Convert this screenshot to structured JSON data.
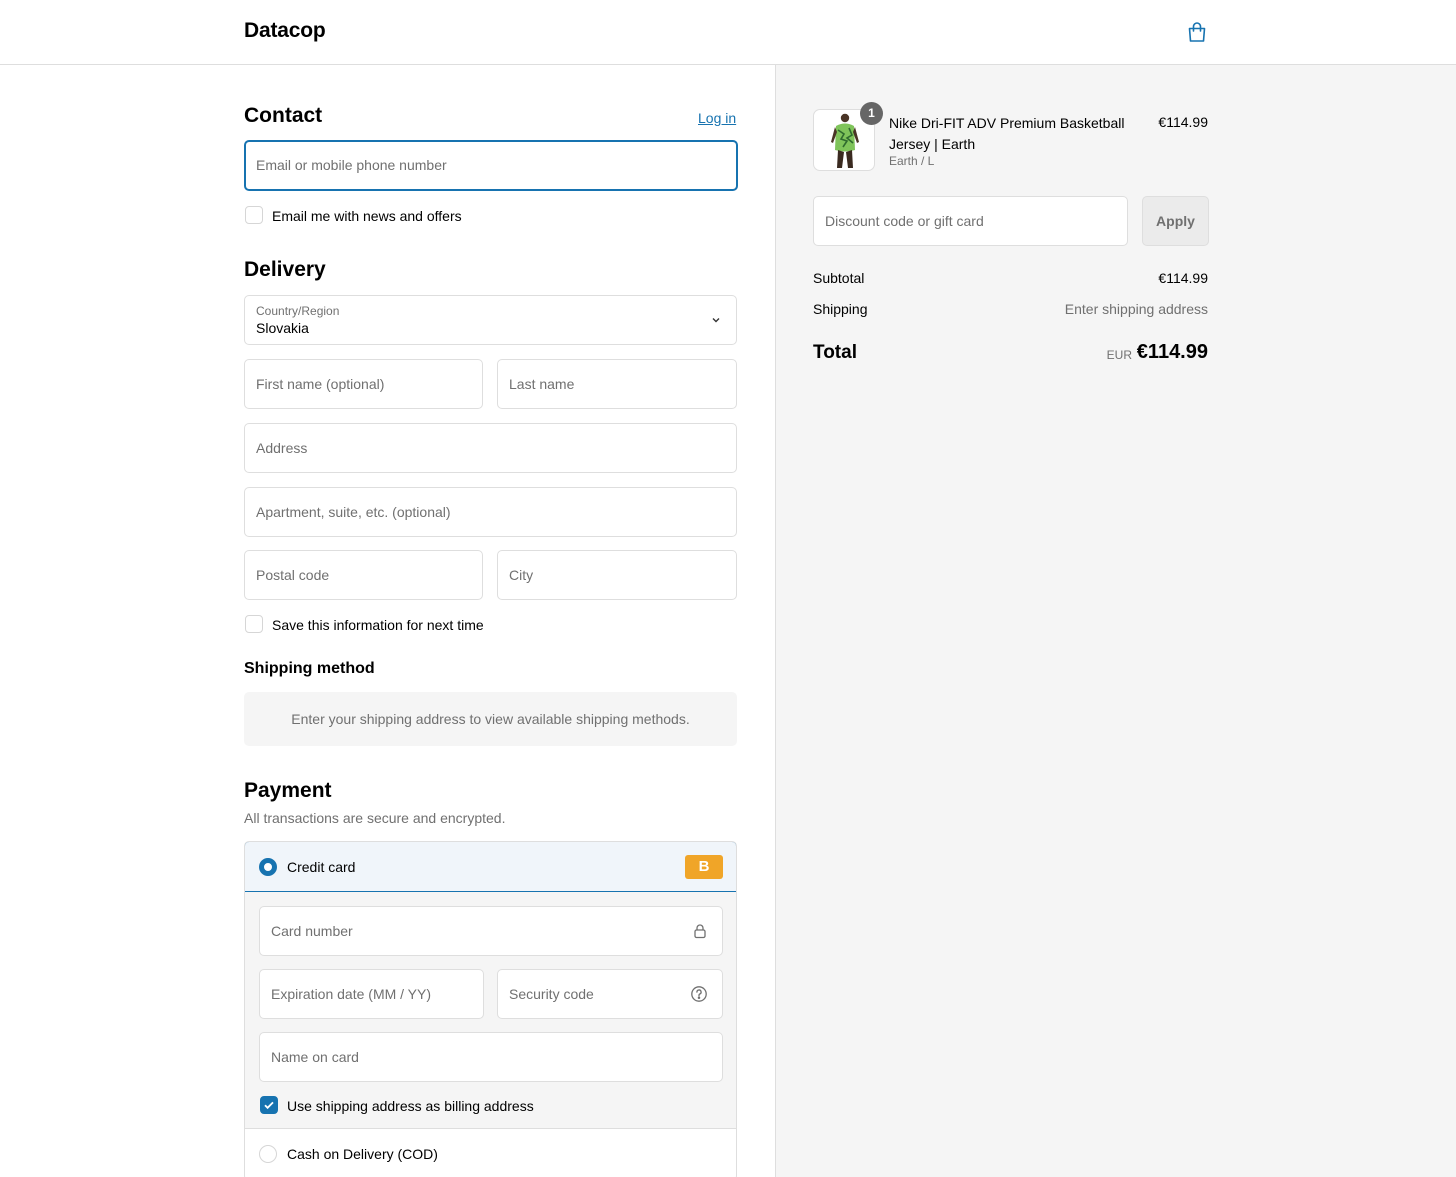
{
  "header": {
    "brand": "Datacop"
  },
  "contact": {
    "title": "Contact",
    "login_link": "Log in",
    "email_placeholder": "Email or mobile phone number",
    "newsletter_label": "Email me with news and offers"
  },
  "delivery": {
    "title": "Delivery",
    "country_label": "Country/Region",
    "country_value": "Slovakia",
    "first_name_placeholder": "First name (optional)",
    "last_name_placeholder": "Last name",
    "address_placeholder": "Address",
    "apartment_placeholder": "Apartment, suite, etc. (optional)",
    "postal_placeholder": "Postal code",
    "city_placeholder": "City",
    "save_info_label": "Save this information for next time"
  },
  "shipping_method": {
    "title": "Shipping method",
    "notice": "Enter your shipping address to view available shipping methods."
  },
  "payment": {
    "title": "Payment",
    "subtitle": "All transactions are secure and encrypted.",
    "credit_card_label": "Credit card",
    "card_badge": "B",
    "card_number_placeholder": "Card number",
    "expiry_placeholder": "Expiration date (MM / YY)",
    "security_placeholder": "Security code",
    "name_on_card_placeholder": "Name on card",
    "billing_same_label": "Use shipping address as billing address",
    "cod_label": "Cash on Delivery (COD)"
  },
  "summary": {
    "product": {
      "name": "Nike Dri-FIT ADV Premium Basketball Jersey | Earth",
      "variant": "Earth / L",
      "price": "€114.99",
      "quantity": "1"
    },
    "discount_placeholder": "Discount code or gift card",
    "apply_label": "Apply",
    "subtotal_label": "Subtotal",
    "subtotal_value": "€114.99",
    "shipping_label": "Shipping",
    "shipping_value": "Enter shipping address",
    "total_label": "Total",
    "total_currency": "EUR",
    "total_value": "€114.99"
  },
  "colors": {
    "accent": "#1773b0",
    "badge": "#f0a528"
  }
}
